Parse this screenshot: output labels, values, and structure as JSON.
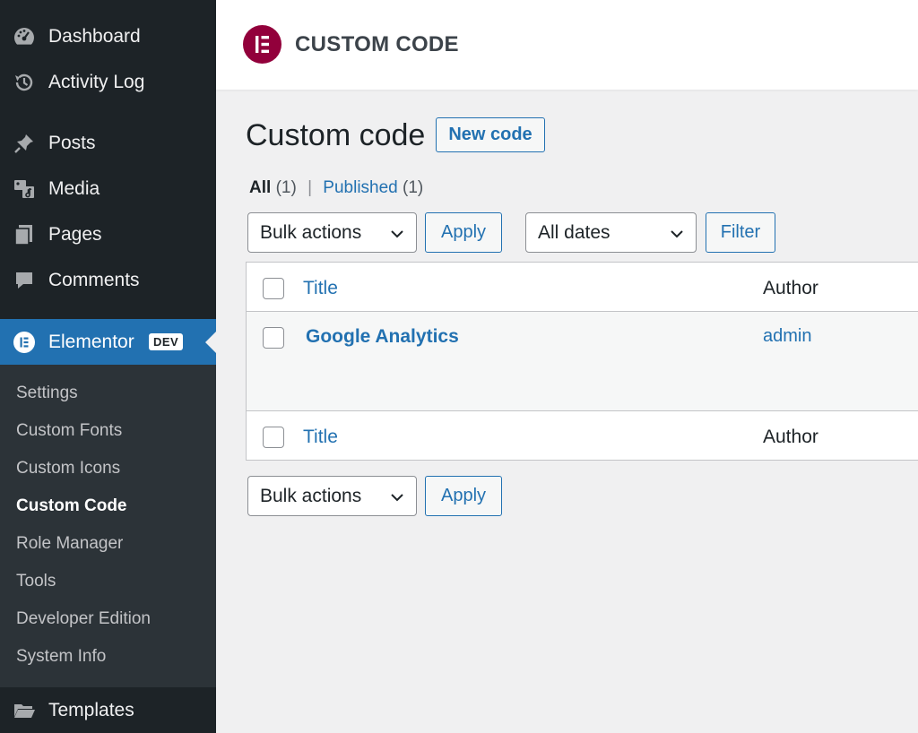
{
  "sidebar": {
    "items": [
      {
        "label": "Dashboard",
        "icon": "dashboard-icon"
      },
      {
        "label": "Activity Log",
        "icon": "history-icon"
      },
      {
        "label": "Posts",
        "icon": "pin-icon"
      },
      {
        "label": "Media",
        "icon": "media-icon"
      },
      {
        "label": "Pages",
        "icon": "pages-icon"
      },
      {
        "label": "Comments",
        "icon": "comment-icon"
      },
      {
        "label": "Elementor",
        "icon": "elementor-icon",
        "badge": "DEV",
        "active": true
      },
      {
        "label": "Templates",
        "icon": "folder-icon"
      }
    ],
    "submenu": [
      {
        "label": "Settings"
      },
      {
        "label": "Custom Fonts"
      },
      {
        "label": "Custom Icons"
      },
      {
        "label": "Custom Code",
        "current": true
      },
      {
        "label": "Role Manager"
      },
      {
        "label": "Tools"
      },
      {
        "label": "Developer Edition"
      },
      {
        "label": "System Info"
      }
    ]
  },
  "header": {
    "title": "CUSTOM CODE"
  },
  "main": {
    "title": "Custom code",
    "new_button": "New code",
    "views": {
      "all_label": "All",
      "all_count": "(1)",
      "separator": "|",
      "published_label": "Published",
      "published_count": "(1)"
    },
    "filters": {
      "bulk_actions": "Bulk actions",
      "apply": "Apply",
      "dates": "All dates",
      "filter": "Filter"
    },
    "table": {
      "columns": [
        "Title",
        "Author"
      ],
      "rows": [
        {
          "title": "Google Analytics",
          "author": "admin"
        }
      ]
    },
    "bottom": {
      "bulk_actions": "Bulk actions",
      "apply": "Apply"
    }
  },
  "colors": {
    "sidebar_bg": "#1d2327",
    "submenu_bg": "#2c3338",
    "accent": "#2271b1",
    "brand": "#92003b"
  }
}
